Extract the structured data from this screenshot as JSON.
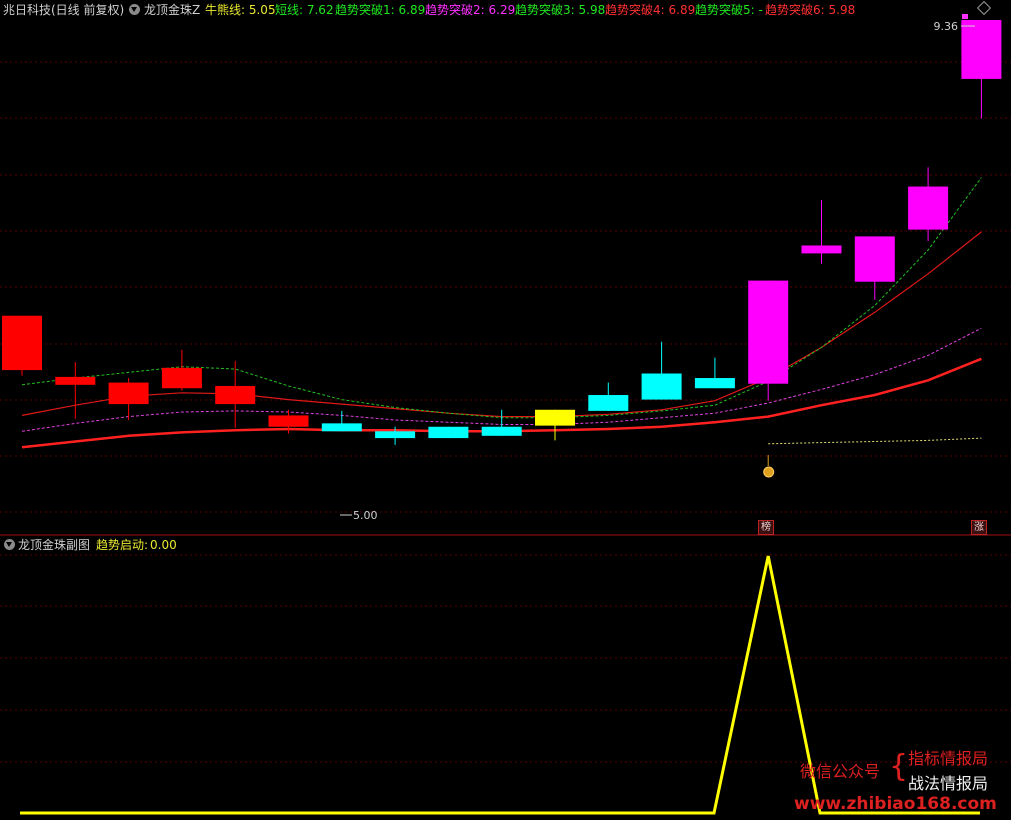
{
  "header": {
    "stock": "兆日科技(日线 前复权)",
    "indicator": "龙顶金珠Z",
    "metrics": [
      {
        "label": "牛熊线: ",
        "value": "5.05",
        "color": "#e8e830"
      },
      {
        "label": "短线: ",
        "value": "7.62",
        "color": "#20e820"
      },
      {
        "label": "趋势突破1: ",
        "value": "6.89",
        "color": "#20e820"
      },
      {
        "label": "趋势突破2: ",
        "value": "6.29",
        "color": "#ff30ff"
      },
      {
        "label": "趋势突破3: ",
        "value": "5.98",
        "color": "#20e820"
      },
      {
        "label": "趋势突破4: ",
        "value": "6.89",
        "color": "#ff3030"
      },
      {
        "label": "趋势突破5: ",
        "value": "-",
        "color": "#20e820"
      },
      {
        "label": "趋势突破6: ",
        "value": "5.98",
        "color": "#ff3030"
      }
    ]
  },
  "main_chart": {
    "high_label": "9.36",
    "low_label": "5.00",
    "markers": [
      "榜",
      "涨"
    ],
    "colors": {
      "bull": "#ff0000",
      "bear": "#00ffff",
      "doji": "#ffff00",
      "surge": "#ff00ff",
      "grid": "#5a0000"
    },
    "candles": [
      {
        "o": 6.27,
        "c": 6.75,
        "h": 6.75,
        "l": 6.22
      },
      {
        "o": 6.21,
        "c": 6.14,
        "h": 6.34,
        "l": 5.84
      },
      {
        "o": 5.97,
        "c": 6.16,
        "h": 6.2,
        "l": 5.83
      },
      {
        "o": 6.11,
        "c": 6.29,
        "h": 6.45,
        "l": 6.09
      },
      {
        "o": 5.97,
        "c": 6.13,
        "h": 6.35,
        "l": 5.76
      },
      {
        "o": 5.77,
        "c": 5.87,
        "h": 5.92,
        "l": 5.71
      },
      {
        "o": 5.8,
        "c": 5.73,
        "h": 5.91,
        "l": 5.73
      },
      {
        "o": 5.67,
        "c": 5.73,
        "h": 5.77,
        "l": 5.61
      },
      {
        "o": 5.67,
        "c": 5.77,
        "h": 5.77,
        "l": 5.67
      },
      {
        "o": 5.69,
        "c": 5.77,
        "h": 5.92,
        "l": 5.69
      },
      {
        "o": 5.78,
        "c": 5.92,
        "h": 5.92,
        "l": 5.65
      },
      {
        "o": 5.91,
        "c": 6.05,
        "h": 6.16,
        "l": 5.91
      },
      {
        "o": 6.01,
        "c": 6.24,
        "h": 6.52,
        "l": 6.01
      },
      {
        "o": 6.11,
        "c": 6.2,
        "h": 6.38,
        "l": 6.11
      },
      {
        "o": 6.15,
        "c": 7.06,
        "h": 7.06,
        "l": 6.0
      },
      {
        "o": 7.3,
        "c": 7.37,
        "h": 7.77,
        "l": 7.21
      },
      {
        "o": 7.05,
        "c": 7.45,
        "h": 7.45,
        "l": 6.89
      },
      {
        "o": 7.51,
        "c": 7.89,
        "h": 8.06,
        "l": 7.41
      },
      {
        "o": 8.84,
        "c": 9.36,
        "h": 9.36,
        "l": 8.49
      }
    ],
    "lines": {
      "short_green": [
        6.14,
        6.2,
        6.25,
        6.3,
        6.28,
        6.13,
        6.01,
        5.94,
        5.89,
        5.85,
        5.85,
        5.87,
        5.91,
        5.96,
        6.17,
        6.47,
        6.84,
        7.33,
        7.97
      ],
      "trend_red": [
        5.87,
        5.96,
        6.04,
        6.07,
        6.06,
        6.01,
        5.97,
        5.93,
        5.89,
        5.86,
        5.86,
        5.88,
        5.92,
        6.0,
        6.2,
        6.47,
        6.78,
        7.12,
        7.49
      ],
      "magenta": [
        5.73,
        5.8,
        5.86,
        5.9,
        5.91,
        5.9,
        5.87,
        5.83,
        5.81,
        5.79,
        5.79,
        5.81,
        5.85,
        5.89,
        5.98,
        6.1,
        6.23,
        6.4,
        6.64
      ],
      "base_red": [
        5.59,
        5.64,
        5.69,
        5.72,
        5.74,
        5.75,
        5.74,
        5.74,
        5.73,
        5.73,
        5.74,
        5.75,
        5.77,
        5.81,
        5.86,
        5.96,
        6.05,
        6.18,
        6.37
      ],
      "yellow_dot": [
        5.62,
        5.63,
        5.64,
        5.65,
        5.67
      ]
    }
  },
  "sub_chart": {
    "title": "龙顶金珠副图",
    "metric_label": "趋势启动: ",
    "metric_value": "0.00",
    "values": [
      0,
      0,
      0,
      0,
      0,
      0,
      0,
      0,
      0,
      0,
      0,
      0,
      0,
      0,
      1,
      0,
      0,
      0,
      0
    ]
  },
  "watermark": {
    "wechat": "微信公众号",
    "line1": "指标情报局",
    "line2": "战法情报局",
    "url": "www.zhibiao168.com"
  }
}
